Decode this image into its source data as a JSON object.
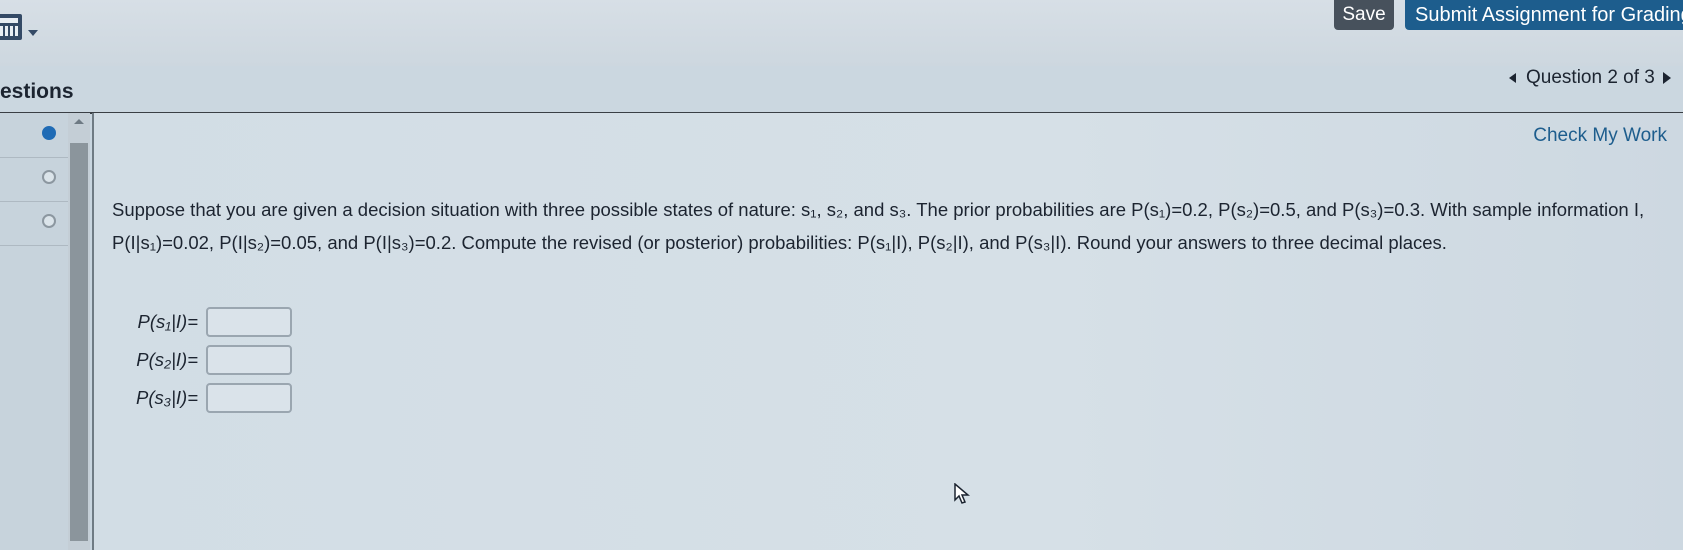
{
  "toolbar": {
    "save_label": "Save",
    "submit_label": "Submit Assignment for Grading"
  },
  "sidebar": {
    "title": "estions",
    "items": [
      {
        "state": "current"
      },
      {
        "state": "unanswered"
      },
      {
        "state": "unanswered"
      }
    ]
  },
  "question_nav": {
    "label": "Question 2 of 3"
  },
  "main": {
    "check_work_label": "Check My Work",
    "problem_text": "Suppose that you are given a decision situation with three possible states of nature: s₁, s₂, and s₃. The prior probabilities are P(s₁)=0.2, P(s₂)=0.5, and P(s₃)=0.3. With sample information I, P(I|s₁)=0.02, P(I|s₂)=0.05, and P(I|s₃)=0.2. Compute the revised (or posterior) probabilities: P(s₁|I), P(s₂|I), and P(s₃|I). Round your answers to three decimal places.",
    "answers": [
      {
        "label": "P(s₁|I)=",
        "value": ""
      },
      {
        "label": "P(s₂|I)=",
        "value": ""
      },
      {
        "label": "P(s₃|I)=",
        "value": ""
      }
    ]
  },
  "colors": {
    "accent": "#1d5d8d",
    "save_button": "#47515c",
    "current_dot": "#1f6bb5"
  },
  "icons": [
    "calculator-icon",
    "dropdown-caret-icon",
    "prev-question-icon",
    "next-question-icon",
    "scroll-up-icon",
    "mouse-cursor-icon"
  ]
}
